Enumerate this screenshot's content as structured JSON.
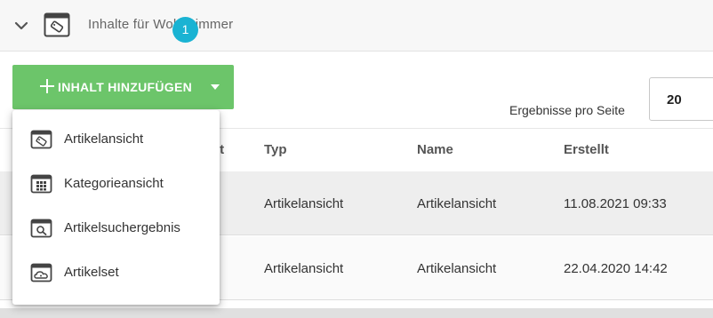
{
  "header": {
    "title": "Inhalte für Wohnzimmer",
    "expand_icon": "chevron-down-icon",
    "section_icon": "tag-window-icon"
  },
  "toolbar": {
    "add_label": "INHALT HINZUFÜGEN",
    "add_color": "#6cc56a",
    "results_per_page_label": "Ergebnisse pro Seite",
    "results_per_page_value": "20"
  },
  "menu": {
    "items": [
      {
        "label": "Artikelansicht",
        "icon": "tag-window-icon"
      },
      {
        "label": "Kategorieansicht",
        "icon": "grid-window-icon"
      },
      {
        "label": "Artikelsuchergebnis",
        "icon": "search-window-icon"
      },
      {
        "label": "Artikelset",
        "icon": "cloud-tag-window-icon"
      }
    ],
    "badge": "1",
    "badge_color": "#1ab3d3"
  },
  "table": {
    "partial_header": "it",
    "columns": [
      "Typ",
      "Name",
      "Erstellt"
    ],
    "rows": [
      {
        "typ": "Artikelansicht",
        "name": "Artikelansicht",
        "erstellt": "11.08.2021 09:33"
      },
      {
        "typ": "Artikelansicht",
        "name": "Artikelansicht",
        "erstellt": "22.04.2020 14:42"
      }
    ]
  }
}
